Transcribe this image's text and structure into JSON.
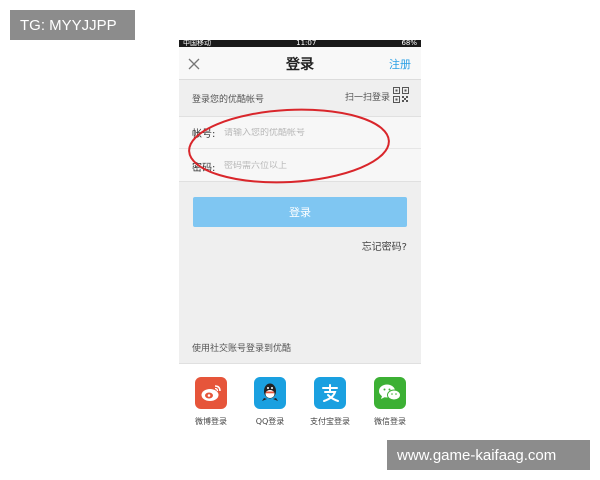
{
  "watermarks": {
    "top_left": "TG: MYYJJPP",
    "bottom_right": "www.game-kaifaag.com"
  },
  "statusbar": {
    "carrier": "中国移动",
    "time": "11:07",
    "battery": "68%"
  },
  "navbar": {
    "title": "登录",
    "register_label": "注册",
    "close_icon": "close-icon"
  },
  "login_section": {
    "header": "登录您的优酷帐号",
    "scan_label": "扫一扫登录",
    "scan_icon": "qr-code-icon"
  },
  "form": {
    "account_label": "帐号:",
    "account_placeholder": "请输入您的优酷帐号",
    "password_label": "密码:",
    "password_placeholder": "密码需六位以上"
  },
  "login_button": "登录",
  "forgot_password": "忘记密码?",
  "social": {
    "title": "使用社交账号登录到优酷",
    "items": [
      {
        "label": "微博登录",
        "icon": "weibo-icon",
        "color": "#e6553a"
      },
      {
        "label": "QQ登录",
        "icon": "qq-icon",
        "color": "#1aa0e0"
      },
      {
        "label": "支付宝登录",
        "icon": "alipay-icon",
        "color": "#1aa0e0"
      },
      {
        "label": "微信登录",
        "icon": "wechat-icon",
        "color": "#3cb034"
      }
    ]
  },
  "colors": {
    "accent": "#2aa0e6",
    "login_button": "#7fc6f2",
    "annotation_ellipse": "#d9262b",
    "watermark_bg": "#8c8c8c"
  }
}
